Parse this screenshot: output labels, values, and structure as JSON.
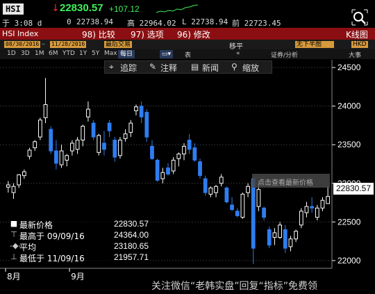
{
  "header": {
    "ticker": "HSI",
    "last_price": "22830.57",
    "change": "+107.12"
  },
  "quote": {
    "time": "于 3:08 d",
    "bid": "0",
    "open": "22738.94",
    "high": "高 22964.02",
    "low": "L 22738.94",
    "prev": "前 22723.45"
  },
  "menubar": {
    "index_label": "HSI Index",
    "compare": "98) 比较",
    "options": "97) 选项",
    "actions": "96) 修改",
    "kline": "K线图"
  },
  "toolbar1": {
    "date_from": "08/30/2016",
    "date_to": "11/28/2016",
    "recent": "最后交易",
    "level": "移平",
    "currency": "HKD",
    "halfyear": "无下半图"
  },
  "toolbar2": {
    "periods": [
      "1D",
      "3D",
      "1M",
      "6M",
      "YTD",
      "1Y",
      "5Y",
      "Max"
    ],
    "interval": "每日",
    "extra": "表",
    "notes": "证券/分析",
    "mode": "大事"
  },
  "chart_tools": {
    "track": "追踪",
    "annotate": "注释",
    "news": "新闻",
    "zoom": "缩放"
  },
  "legend": {
    "items": [
      {
        "name": "最新价格",
        "value": "22830.57"
      },
      {
        "name": "最高于 09/09/16",
        "value": "24364.00"
      },
      {
        "name": "平均",
        "value": "23180.65"
      },
      {
        "name": "最低于 11/09/16",
        "value": "21957.71"
      }
    ]
  },
  "price_label": "22830.57",
  "tooltip_hint": "点击查看最新价格",
  "watermark": "关注微信“老韩实盘”回复“指标”免费领",
  "colors": {
    "up": "#ffffff",
    "down": "#2f7df0",
    "accent_red": "#8b0f12",
    "green": "#3df25a"
  },
  "chart_data": {
    "type": "candlestick",
    "ylim": [
      21900,
      24600
    ],
    "yticks": [
      22000,
      22500,
      23000,
      23500,
      24000,
      24500
    ],
    "xticks": [
      {
        "label": "8月",
        "index": 0
      },
      {
        "label": "9月",
        "index": 12
      }
    ],
    "candles": [
      {
        "o": 22950,
        "h": 23030,
        "l": 22880,
        "c": 22980
      },
      {
        "o": 22880,
        "h": 23000,
        "l": 22800,
        "c": 22960
      },
      {
        "o": 22980,
        "h": 23120,
        "l": 22940,
        "c": 23110
      },
      {
        "o": 23100,
        "h": 23180,
        "l": 23060,
        "c": 23150
      },
      {
        "o": 23350,
        "h": 23460,
        "l": 23310,
        "c": 23430
      },
      {
        "o": 23460,
        "h": 23560,
        "l": 23420,
        "c": 23540
      },
      {
        "o": 23600,
        "h": 23850,
        "l": 23560,
        "c": 23820
      },
      {
        "o": 23850,
        "h": 24364,
        "l": 23780,
        "c": 24020
      },
      {
        "o": 23700,
        "h": 23740,
        "l": 23380,
        "c": 23420
      },
      {
        "o": 23420,
        "h": 23560,
        "l": 23180,
        "c": 23260
      },
      {
        "o": 23240,
        "h": 23500,
        "l": 23200,
        "c": 23420
      },
      {
        "o": 23300,
        "h": 23380,
        "l": 23220,
        "c": 23360
      },
      {
        "o": 23420,
        "h": 23560,
        "l": 23360,
        "c": 23520
      },
      {
        "o": 23440,
        "h": 23600,
        "l": 23380,
        "c": 23560
      },
      {
        "o": 23560,
        "h": 23760,
        "l": 23480,
        "c": 23740
      },
      {
        "o": 23860,
        "h": 24060,
        "l": 23800,
        "c": 23960
      },
      {
        "o": 23780,
        "h": 23820,
        "l": 23560,
        "c": 23600
      },
      {
        "o": 23400,
        "h": 23640,
        "l": 23360,
        "c": 23620
      },
      {
        "o": 23520,
        "h": 23680,
        "l": 23360,
        "c": 23440
      },
      {
        "o": 23780,
        "h": 23820,
        "l": 23600,
        "c": 23680
      },
      {
        "o": 23560,
        "h": 23600,
        "l": 23280,
        "c": 23340
      },
      {
        "o": 23360,
        "h": 23600,
        "l": 23320,
        "c": 23560
      },
      {
        "o": 23580,
        "h": 23700,
        "l": 23540,
        "c": 23640
      },
      {
        "o": 23660,
        "h": 23820,
        "l": 23600,
        "c": 23780
      },
      {
        "o": 23940,
        "h": 24020,
        "l": 23880,
        "c": 23990
      },
      {
        "o": 24000,
        "h": 24060,
        "l": 23780,
        "c": 23860
      },
      {
        "o": 23920,
        "h": 23960,
        "l": 23540,
        "c": 23600
      },
      {
        "o": 23480,
        "h": 23560,
        "l": 23300,
        "c": 23320
      },
      {
        "o": 23300,
        "h": 23320,
        "l": 23020,
        "c": 23040
      },
      {
        "o": 23060,
        "h": 23200,
        "l": 23000,
        "c": 23140
      },
      {
        "o": 23200,
        "h": 23260,
        "l": 23100,
        "c": 23120
      },
      {
        "o": 23160,
        "h": 23340,
        "l": 23120,
        "c": 23300
      },
      {
        "o": 23320,
        "h": 23400,
        "l": 23220,
        "c": 23380
      },
      {
        "o": 23380,
        "h": 23520,
        "l": 23300,
        "c": 23480
      },
      {
        "o": 23560,
        "h": 23640,
        "l": 23380,
        "c": 23440
      },
      {
        "o": 23460,
        "h": 23520,
        "l": 23280,
        "c": 23300
      },
      {
        "o": 23280,
        "h": 23320,
        "l": 23060,
        "c": 23100
      },
      {
        "o": 23060,
        "h": 23100,
        "l": 22840,
        "c": 22880
      },
      {
        "o": 22860,
        "h": 22960,
        "l": 22820,
        "c": 22940
      },
      {
        "o": 22880,
        "h": 22980,
        "l": 22820,
        "c": 22960
      },
      {
        "o": 23000,
        "h": 23120,
        "l": 22960,
        "c": 23080
      },
      {
        "o": 22940,
        "h": 22960,
        "l": 22740,
        "c": 22760
      },
      {
        "o": 22720,
        "h": 22820,
        "l": 22640,
        "c": 22660
      },
      {
        "o": 22640,
        "h": 22680,
        "l": 22560,
        "c": 22580
      },
      {
        "o": 22560,
        "h": 22880,
        "l": 22540,
        "c": 22860
      },
      {
        "o": 22880,
        "h": 23000,
        "l": 22820,
        "c": 22960
      },
      {
        "o": 23060,
        "h": 23080,
        "l": 21957,
        "c": 22160
      },
      {
        "o": 22700,
        "h": 23000,
        "l": 22640,
        "c": 22920
      },
      {
        "o": 22680,
        "h": 22700,
        "l": 22520,
        "c": 22560
      },
      {
        "o": 22400,
        "h": 22440,
        "l": 22160,
        "c": 22200
      },
      {
        "o": 22300,
        "h": 22420,
        "l": 22200,
        "c": 22360
      },
      {
        "o": 22300,
        "h": 22500,
        "l": 22280,
        "c": 22460
      },
      {
        "o": 22400,
        "h": 22460,
        "l": 22100,
        "c": 22160
      },
      {
        "o": 22180,
        "h": 22320,
        "l": 22120,
        "c": 22280
      },
      {
        "o": 22280,
        "h": 22400,
        "l": 22240,
        "c": 22380
      },
      {
        "o": 22460,
        "h": 22680,
        "l": 22420,
        "c": 22640
      },
      {
        "o": 22620,
        "h": 22760,
        "l": 22560,
        "c": 22700
      },
      {
        "o": 22700,
        "h": 22820,
        "l": 22620,
        "c": 22680
      },
      {
        "o": 22560,
        "h": 22720,
        "l": 22520,
        "c": 22680
      },
      {
        "o": 22680,
        "h": 22820,
        "l": 22640,
        "c": 22780
      },
      {
        "o": 22738,
        "h": 22964,
        "l": 22738,
        "c": 22830
      }
    ]
  }
}
